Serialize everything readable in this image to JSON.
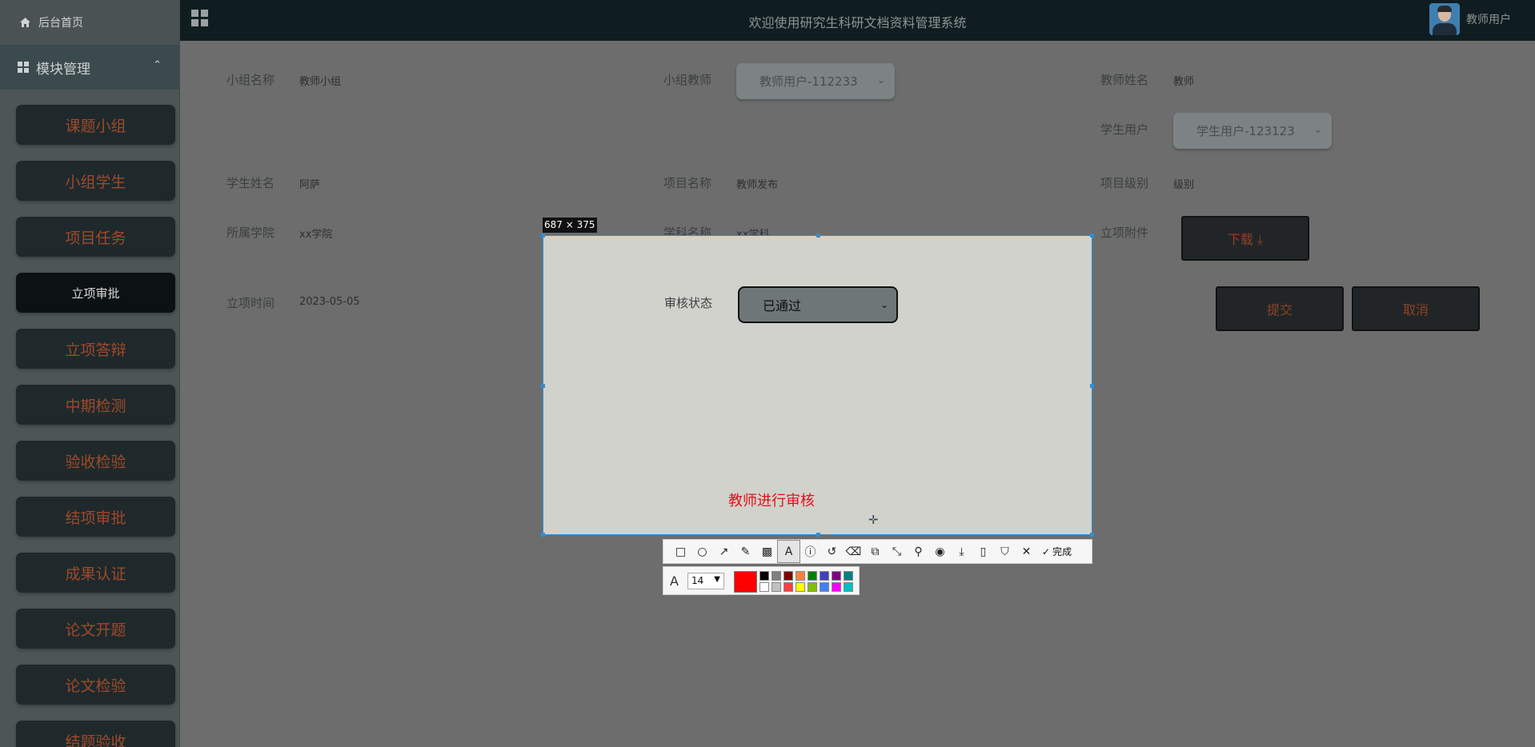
{
  "sidebar": {
    "home_label": "后台首页",
    "module_label": "模块管理",
    "items": [
      {
        "label": "课题小组",
        "active": false
      },
      {
        "label": "小组学生",
        "active": false
      },
      {
        "label": "项目任务",
        "active": false
      },
      {
        "label": "立项审批",
        "active": true
      },
      {
        "label": "立项答辩",
        "active": false
      },
      {
        "label": "中期检测",
        "active": false
      },
      {
        "label": "验收检验",
        "active": false
      },
      {
        "label": "结项审批",
        "active": false
      },
      {
        "label": "成果认证",
        "active": false
      },
      {
        "label": "论文开题",
        "active": false
      },
      {
        "label": "论文检验",
        "active": false
      },
      {
        "label": "结题验收",
        "active": false
      }
    ]
  },
  "topbar": {
    "title": "欢迎使用研究生科研文档资料管理系统",
    "user_name": "教师用户"
  },
  "form": {
    "group_name_label": "小组名称",
    "group_name_value": "教师小组",
    "group_teacher_label": "小组教师",
    "group_teacher_value": "教师用户-112233",
    "teacher_name_label": "教师姓名",
    "teacher_name_value": "教师",
    "student_user_label": "学生用户",
    "student_user_value": "学生用户-123123",
    "student_name_label": "学生姓名",
    "student_name_value": "阿萨",
    "project_name_label": "项目名称",
    "project_name_value": "教师发布",
    "project_level_label": "项目级别",
    "project_level_value": "级别",
    "college_label": "所属学院",
    "college_value": "xx学院",
    "subject_label": "学科名称",
    "subject_value": "xx学科",
    "attachment_label": "立项附件",
    "download_button": "下载 ⤓",
    "time_label": "立项时间",
    "time_value": "2023-05-05",
    "submit_button": "提交",
    "cancel_button": "取消"
  },
  "capture": {
    "dimensions": "687 × 375",
    "status_label": "审核状态",
    "status_value": "已通过",
    "annotation_text": "教师进行审核",
    "done_label": "完成",
    "font_size": "14",
    "current_color": "#ff0000",
    "palette_top": [
      "#000000",
      "#808080",
      "#800000",
      "#ff8040",
      "#008000",
      "#4040c0",
      "#800080",
      "#008080"
    ],
    "palette_bottom": [
      "#ffffff",
      "#c0c0c0",
      "#ff4040",
      "#ffff00",
      "#80c000",
      "#4080ff",
      "#ff00ff",
      "#00c0c0"
    ]
  }
}
